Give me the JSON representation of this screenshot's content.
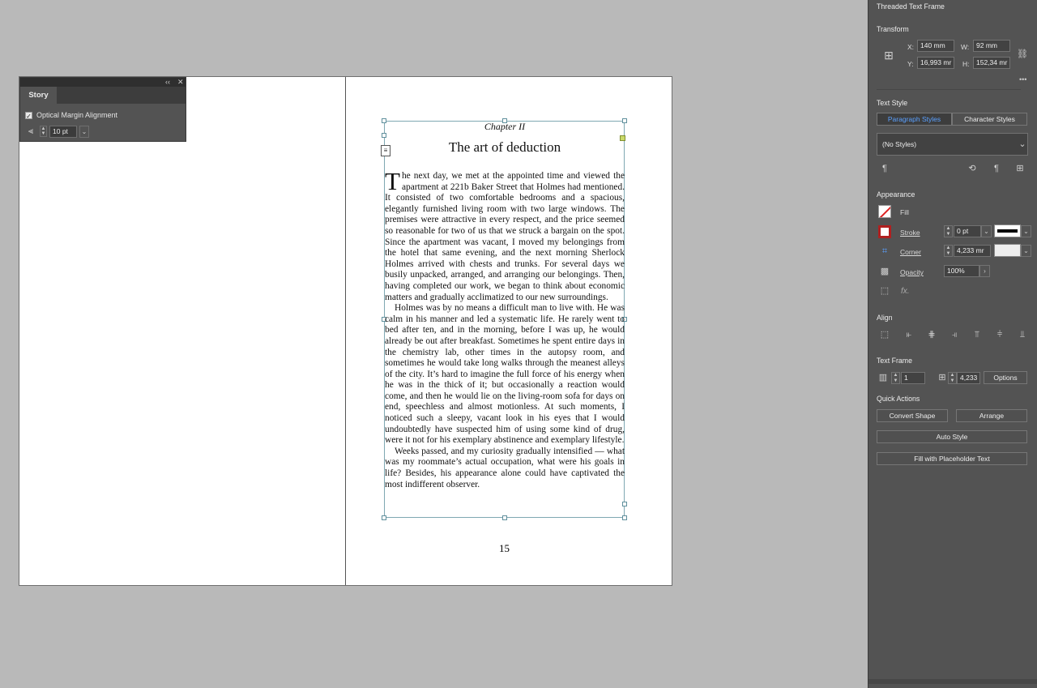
{
  "document": {
    "chapter": "Chapter II",
    "title": "The art of deduction",
    "drop_cap": "T",
    "paragraphs": [
      "he next day, we met at the appointed time and viewed the apartment at 221b Baker Street that Holmes had mentioned. It consisted of two comfortable bedrooms and a spacious, elegantly furnished living room with two large windows. The premises were attractive in every respect, and the price seemed so reasonable for two of us that we struck a bargain on the spot. Since the apartment was vacant, I moved my belongings from the hotel that same evening, and the next morning Sherlock Holmes arrived with chests and trunks. For several days we busily unpacked, arranged, and arranging our belongings. Then, having completed our work, we began to think about economic matters and gradually acclimatized to our new surroundings.",
      "Holmes was by no means a difficult man to live with. He was calm in his manner and led a systematic life. He rarely went to bed after ten, and in the morning, before I was up, he would already be out after breakfast. Sometimes he spent entire days in the chemistry lab, other times in the autopsy room, and sometimes he would take long walks through the meanest alleys of the city. It’s hard to imagine the full force of his energy when he was in the thick of it; but occasionally a reaction would come, and then he would lie on the living-room sofa for days on end, speechless and almost motionless. At such moments, I noticed such a sleepy, vacant look in his eyes that I would undoubtedly have suspected him of using some kind of drug, were it not for his exemplary abstinence and exemplary lifestyle.",
      "Weeks passed, and my curiosity gradually intensified — what was my roommate’s actual occupation, what were his goals in life? Besides, his appearance alone could have captivated the most indifferent observer."
    ],
    "page_number": "15"
  },
  "story_panel": {
    "tab": "Story",
    "collapse_glyph": "‹‹",
    "close_glyph": "✕",
    "checkbox_label": "Optical Margin Alignment",
    "checkbox_checked": true,
    "size_value": "10 pt"
  },
  "properties": {
    "title": "Threaded Text Frame",
    "transform": {
      "heading": "Transform",
      "x_label": "X:",
      "x_value": "140 mm",
      "y_label": "Y:",
      "y_value": "16,993 mr",
      "w_label": "W:",
      "w_value": "92 mm",
      "h_label": "H:",
      "h_value": "152,34 mr",
      "more": "•••"
    },
    "text_style": {
      "heading": "Text Style",
      "tab_paragraph": "Paragraph Styles",
      "tab_character": "Character Styles",
      "style_value": "(No Styles)"
    },
    "appearance": {
      "heading": "Appearance",
      "fill_label": "Fill",
      "stroke_label": "Stroke",
      "stroke_value": "0 pt",
      "corner_label": "Corner",
      "corner_value": "4,233 mr",
      "opacity_label": "Opacity",
      "opacity_value": "100%",
      "fx_label": "fx."
    },
    "align": {
      "heading": "Align"
    },
    "text_frame": {
      "heading": "Text Frame",
      "columns_value": "1",
      "gutter_value": "4,233",
      "options_label": "Options"
    },
    "quick_actions": {
      "heading": "Quick Actions",
      "convert_shape": "Convert Shape",
      "arrange": "Arrange",
      "auto_style": "Auto Style",
      "fill_placeholder": "Fill with Placeholder Text"
    },
    "colors": {
      "panel_bg": "#535353",
      "accent_tab": "#3a7bd5",
      "frame_border": "#7fa8b2",
      "stroke_swatch": "#000000"
    }
  }
}
